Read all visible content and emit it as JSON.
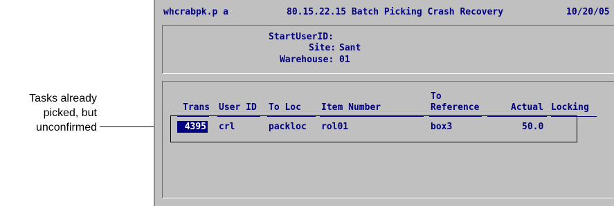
{
  "callout": {
    "lines": [
      "Tasks already",
      "picked, but",
      "unconfirmed"
    ]
  },
  "title_bar": {
    "program": "whcrabpk.p a",
    "title": "80.15.22.15 Batch Picking Crash Recovery",
    "date": "10/20/05"
  },
  "header_form": {
    "start_user_label": "StartUserID:",
    "start_user_value": "",
    "site_label": "Site:",
    "site_value": "Sant",
    "warehouse_label": "Warehouse:",
    "warehouse_value": "01"
  },
  "table": {
    "columns": {
      "trans": "Trans",
      "user_id": "User ID",
      "to_loc": "To Loc",
      "item_number": "Item Number",
      "to_ref_line1": "To",
      "to_ref_line2": "Reference",
      "actual": "Actual",
      "locking": "Locking"
    },
    "rows": [
      {
        "trans": "4395",
        "user_id": "crl",
        "to_loc": "packloc",
        "item_number": "rol01",
        "reference": "box3",
        "actual": "50.0",
        "locking": ""
      }
    ]
  }
}
